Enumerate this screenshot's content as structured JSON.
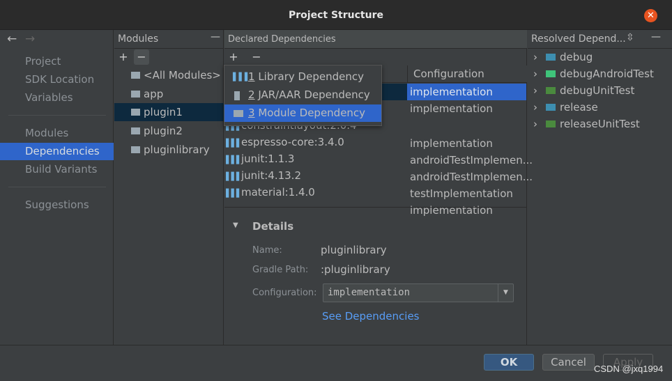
{
  "window": {
    "title": "Project Structure"
  },
  "nav": {
    "back": "←",
    "forward": "→",
    "items": [
      {
        "label": "Project"
      },
      {
        "label": "SDK Location"
      },
      {
        "label": "Variables"
      },
      {
        "label": "Modules"
      },
      {
        "label": "Dependencies"
      },
      {
        "label": "Build Variants"
      },
      {
        "label": "Suggestions"
      }
    ],
    "selected": "Dependencies"
  },
  "modules": {
    "title": "Modules",
    "add": "+",
    "remove": "−",
    "collapse": "—",
    "items": [
      {
        "label": "<All Modules>"
      },
      {
        "label": "app"
      },
      {
        "label": "plugin1"
      },
      {
        "label": "plugin2"
      },
      {
        "label": "pluginlibrary"
      }
    ],
    "selected": "plugin1"
  },
  "declared": {
    "title": "Declared Dependencies",
    "add": "+",
    "remove": "−",
    "column_configuration": "Configuration",
    "rows": [
      {
        "name": "",
        "config": "implementation"
      },
      {
        "name": "",
        "config": "implementation"
      },
      {
        "name": "constraintlayout:2.0.4",
        "config": "implementation"
      },
      {
        "name": "espresso-core:3.4.0",
        "config": "androidTestImplemen..."
      },
      {
        "name": "junit:1.1.3",
        "config": "androidTestImplemen..."
      },
      {
        "name": "junit:4.13.2",
        "config": "testImplementation"
      },
      {
        "name": "material:1.4.0",
        "config": "implementation"
      }
    ]
  },
  "popup": {
    "items": [
      {
        "num": "1",
        "label": "Library Dependency"
      },
      {
        "num": "2",
        "label": "JAR/AAR Dependency"
      },
      {
        "num": "3",
        "label": "Module Dependency"
      }
    ],
    "selected": "Module Dependency"
  },
  "details": {
    "title": "Details",
    "name_label": "Name:",
    "name_value": "pluginlibrary",
    "path_label": "Gradle Path:",
    "path_value": ":pluginlibrary",
    "config_label": "Configuration:",
    "config_value": "implementation",
    "link": "See Dependencies"
  },
  "resolved": {
    "title": "Resolved Depend...",
    "items": [
      {
        "label": "debug",
        "color": "#3d8eb0"
      },
      {
        "label": "debugAndroidTest",
        "color": "#3fc47a"
      },
      {
        "label": "debugUnitTest",
        "color": "#4a8a3e"
      },
      {
        "label": "release",
        "color": "#3d8eb0"
      },
      {
        "label": "releaseUnitTest",
        "color": "#4a8a3e"
      }
    ]
  },
  "buttons": {
    "ok": "OK",
    "cancel": "Cancel",
    "apply": "Apply"
  },
  "watermark": "CSDN @jxq1994",
  "colors": {
    "accent": "#2f65ca",
    "close": "#e95420"
  }
}
